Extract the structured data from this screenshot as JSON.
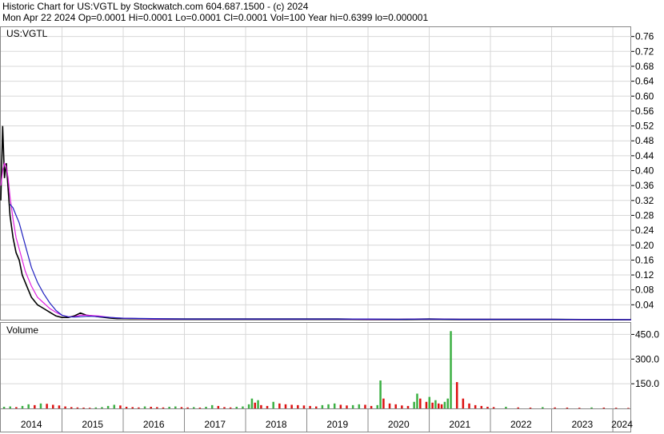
{
  "header": {
    "line1": "Historic Chart for US:VGTL by Stockwatch.com 604.687.1500 - (c) 2024",
    "line2": "Mon Apr 22 2024   Op=0.0001  Hi=0.0001  Lo=0.0001  Cl=0.0001  Vol=100  Year hi=0.6399  lo=0.000001"
  },
  "chart_data": [
    {
      "type": "line",
      "title": "US:VGTL",
      "x": [
        2014.0,
        2014.03,
        2014.06,
        2014.09,
        2014.12,
        2014.15,
        2014.2,
        2014.25,
        2014.3,
        2014.35,
        2014.4,
        2014.45,
        2014.5,
        2014.6,
        2014.7,
        2014.8,
        2014.9,
        2015.0,
        2015.1,
        2015.2,
        2015.3,
        2015.4,
        2015.5,
        2015.6,
        2015.7,
        2015.8,
        2015.9,
        2016.0,
        2016.5,
        2017.0,
        2017.5,
        2018.0,
        2018.5,
        2019.0,
        2019.5,
        2020.0,
        2020.5,
        2021.0,
        2021.5,
        2022.0,
        2022.5,
        2023.0,
        2023.5,
        2024.0,
        2024.3
      ],
      "series": [
        {
          "name": "price",
          "values": [
            0.32,
            0.52,
            0.38,
            0.42,
            0.35,
            0.28,
            0.22,
            0.18,
            0.16,
            0.12,
            0.1,
            0.08,
            0.06,
            0.04,
            0.03,
            0.02,
            0.01,
            0.006,
            0.006,
            0.01,
            0.018,
            0.012,
            0.01,
            0.008,
            0.006,
            0.004,
            0.003,
            0.003,
            0.002,
            0.002,
            0.002,
            0.002,
            0.002,
            0.002,
            0.002,
            0.001,
            0.001,
            0.002,
            0.001,
            0.001,
            0.001,
            0.001,
            0.0005,
            0.0002,
            0.0001
          ]
        },
        {
          "name": "ma-short",
          "values": [
            0.36,
            0.4,
            0.42,
            0.41,
            0.38,
            0.33,
            0.27,
            0.22,
            0.19,
            0.16,
            0.13,
            0.11,
            0.09,
            0.06,
            0.045,
            0.03,
            0.02,
            0.012,
            0.008,
            0.008,
            0.012,
            0.012,
            0.011,
            0.01,
            0.008,
            0.006,
            0.005,
            0.004,
            0.002,
            0.002,
            0.002,
            0.002,
            0.002,
            0.002,
            0.002,
            0.001,
            0.001,
            0.002,
            0.001,
            0.001,
            0.001,
            0.001,
            0.0005,
            0.0002,
            0.0001
          ]
        },
        {
          "name": "ma-long",
          "values": [
            null,
            null,
            null,
            null,
            null,
            0.31,
            0.3,
            0.28,
            0.26,
            0.23,
            0.2,
            0.17,
            0.14,
            0.1,
            0.07,
            0.045,
            0.025,
            0.012,
            0.008,
            0.007,
            0.008,
            0.009,
            0.009,
            0.008,
            0.007,
            0.006,
            0.005,
            0.004,
            0.003,
            0.002,
            0.002,
            0.002,
            0.002,
            0.002,
            0.002,
            0.002,
            0.001,
            0.002,
            0.001,
            0.001,
            0.001,
            0.001,
            0.0007,
            0.0003,
            0.0002
          ]
        }
      ],
      "ylim": [
        0,
        0.785
      ],
      "yticks": [
        "0.76",
        "0.72",
        "0.68",
        "0.64",
        "0.60",
        "0.56",
        "0.52",
        "0.48",
        "0.44",
        "0.40",
        "0.36",
        "0.32",
        "0.28",
        "0.24",
        "0.20",
        "0.16",
        "0.12",
        "0.08",
        "0.04"
      ],
      "grid": true,
      "series_colors": [
        "#000000",
        "#e020e0",
        "#2020c0"
      ]
    },
    {
      "type": "bar",
      "title": "Volume",
      "x": [
        2014.05,
        2014.15,
        2014.25,
        2014.35,
        2014.45,
        2014.55,
        2014.65,
        2014.75,
        2014.85,
        2014.95,
        2015.05,
        2015.15,
        2015.25,
        2015.35,
        2015.45,
        2015.55,
        2015.65,
        2015.75,
        2015.85,
        2015.95,
        2016.05,
        2016.15,
        2016.25,
        2016.35,
        2016.45,
        2016.55,
        2016.65,
        2016.75,
        2016.85,
        2016.95,
        2017.05,
        2017.15,
        2017.25,
        2017.35,
        2017.45,
        2017.55,
        2017.65,
        2017.75,
        2017.85,
        2017.95,
        2018.05,
        2018.1,
        2018.15,
        2018.2,
        2018.25,
        2018.35,
        2018.45,
        2018.55,
        2018.65,
        2018.75,
        2018.85,
        2018.95,
        2019.05,
        2019.15,
        2019.25,
        2019.35,
        2019.45,
        2019.55,
        2019.65,
        2019.75,
        2019.85,
        2019.95,
        2020.05,
        2020.15,
        2020.2,
        2020.25,
        2020.35,
        2020.45,
        2020.55,
        2020.65,
        2020.75,
        2020.8,
        2020.85,
        2020.95,
        2021.0,
        2021.05,
        2021.1,
        2021.15,
        2021.2,
        2021.25,
        2021.3,
        2021.35,
        2021.45,
        2021.55,
        2021.65,
        2021.75,
        2021.85,
        2021.95,
        2022.05,
        2022.25,
        2022.45,
        2022.65,
        2022.85,
        2023.05,
        2023.25,
        2023.45,
        2023.65,
        2023.85,
        2024.05,
        2024.25
      ],
      "series": [
        {
          "name": "volume",
          "values": [
            10,
            12,
            8,
            15,
            25,
            20,
            30,
            28,
            22,
            18,
            12,
            8,
            6,
            5,
            4,
            6,
            8,
            15,
            22,
            18,
            10,
            8,
            6,
            12,
            10,
            8,
            6,
            10,
            12,
            8,
            6,
            8,
            5,
            10,
            20,
            15,
            8,
            6,
            10,
            12,
            25,
            60,
            35,
            50,
            20,
            15,
            40,
            30,
            25,
            22,
            20,
            18,
            15,
            12,
            20,
            25,
            30,
            22,
            18,
            20,
            25,
            22,
            15,
            20,
            170,
            60,
            30,
            25,
            18,
            15,
            40,
            90,
            60,
            40,
            70,
            35,
            50,
            30,
            25,
            40,
            60,
            470,
            160,
            60,
            30,
            20,
            15,
            10,
            8,
            10,
            6,
            5,
            8,
            6,
            5,
            4,
            6,
            5,
            4,
            3
          ]
        }
      ],
      "series_colors": [
        "#3cb043",
        "#dd1111"
      ],
      "ylim": [
        0,
        520
      ],
      "yticks": [
        "450.0",
        "300.0",
        "150.0"
      ],
      "grid": true
    }
  ],
  "xaxis": {
    "labels": [
      "2014",
      "2015",
      "2016",
      "2017",
      "2018",
      "2019",
      "2020",
      "2021",
      "2022",
      "2023",
      "2024"
    ]
  }
}
